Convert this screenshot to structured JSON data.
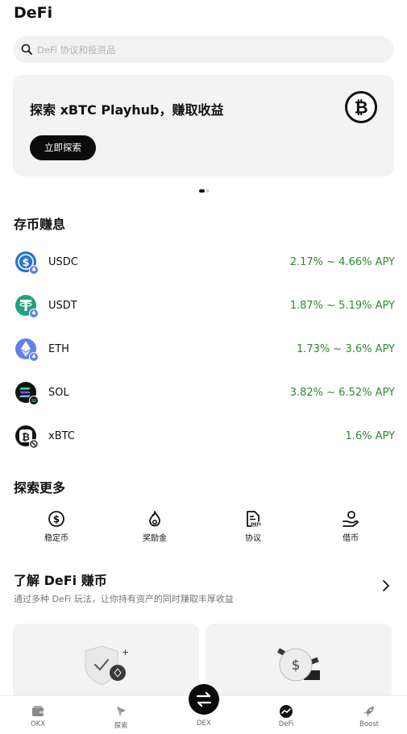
{
  "header": {
    "title": "DeFi"
  },
  "search": {
    "placeholder": "DeFi 协议和投资品"
  },
  "banner": {
    "title": "探索 xBTC Playhub，赚取收益",
    "button_label": "立即探索"
  },
  "earn": {
    "section_title": "存币赚息",
    "items": [
      {
        "name": "USDC",
        "apy": "2.17% ~ 4.66% APY",
        "icon": "usdc-icon"
      },
      {
        "name": "USDT",
        "apy": "1.87% ~ 5.19% APY",
        "icon": "usdt-icon"
      },
      {
        "name": "ETH",
        "apy": "1.73% ~ 3.6% APY",
        "icon": "eth-icon"
      },
      {
        "name": "SOL",
        "apy": "3.82% ~ 6.52% APY",
        "icon": "sol-icon"
      },
      {
        "name": "xBTC",
        "apy": "1.6% APY",
        "icon": "xbtc-icon"
      }
    ]
  },
  "explore": {
    "section_title": "探索更多",
    "items": [
      {
        "label": "稳定币",
        "icon": "dollar-icon"
      },
      {
        "label": "奖励金",
        "icon": "flame-icon"
      },
      {
        "label": "协议",
        "icon": "document-icon"
      },
      {
        "label": "借币",
        "icon": "hand-coin-icon"
      }
    ]
  },
  "learn": {
    "title": "了解 DeFi 赚币",
    "subtitle": "通过多种 DeFi 玩法，让你持有资产的同时赚取丰厚收益"
  },
  "tabbar": {
    "items": [
      {
        "label": "OKX",
        "icon": "wallet-icon"
      },
      {
        "label": "探索",
        "icon": "compass-icon"
      },
      {
        "label": "DEX",
        "icon": "swap-icon"
      },
      {
        "label": "DeFi",
        "icon": "chart-icon",
        "active": true
      },
      {
        "label": "Boost",
        "icon": "rocket-icon"
      }
    ]
  },
  "colors": {
    "apy_green": "#2e8b2e",
    "dark": "#0b0b0b",
    "card_bg": "#f3f3f3"
  }
}
